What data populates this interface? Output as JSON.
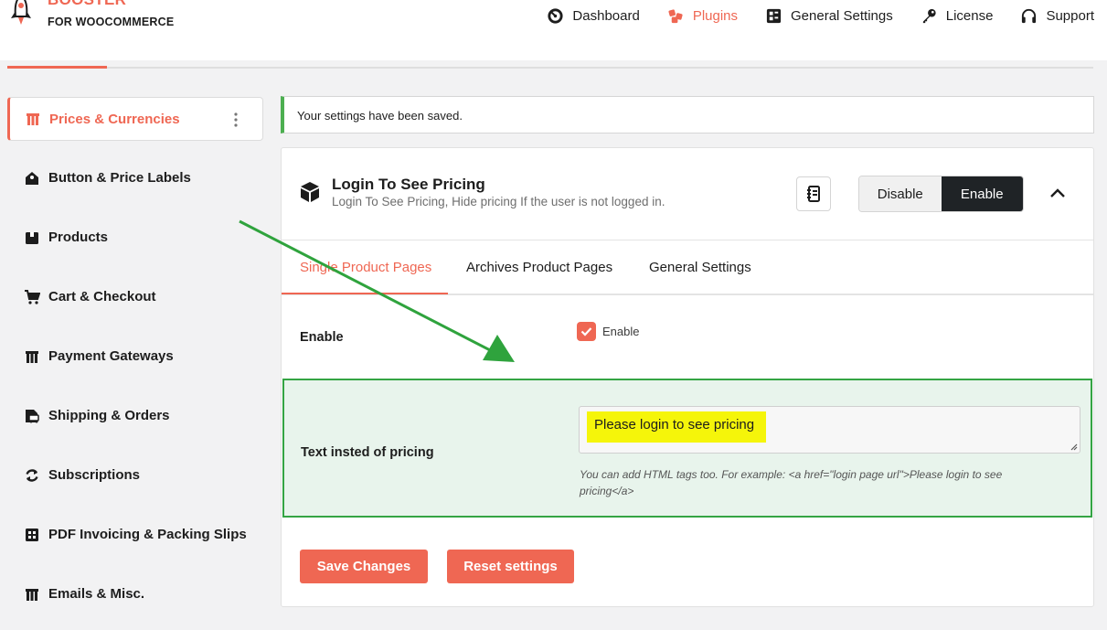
{
  "brand": {
    "name_top": "BOOSTER",
    "name_bottom": "FOR WOOCOMMERCE",
    "accent": "#ef6753"
  },
  "topnav": [
    {
      "label": "Dashboard",
      "icon": "dashboard-gauge-icon",
      "active": false
    },
    {
      "label": "Plugins",
      "icon": "plugins-cubes-icon",
      "active": true
    },
    {
      "label": "General Settings",
      "icon": "settings-grid-icon",
      "active": false
    },
    {
      "label": "License",
      "icon": "key-icon",
      "active": false
    },
    {
      "label": "Support",
      "icon": "headset-icon",
      "active": false
    }
  ],
  "sidebar": {
    "items": [
      {
        "label": "Prices & Currencies",
        "icon": "prices-icon",
        "active": true
      },
      {
        "label": "Button & Price Labels",
        "icon": "label-icon",
        "active": false
      },
      {
        "label": "Products",
        "icon": "box-icon",
        "active": false
      },
      {
        "label": "Cart & Checkout",
        "icon": "cart-icon",
        "active": false
      },
      {
        "label": "Payment Gateways",
        "icon": "payment-icon",
        "active": false
      },
      {
        "label": "Shipping & Orders",
        "icon": "shipping-icon",
        "active": false
      },
      {
        "label": "Subscriptions",
        "icon": "refresh-icon",
        "active": false
      },
      {
        "label": "PDF Invoicing & Packing Slips",
        "icon": "invoice-icon",
        "active": false
      },
      {
        "label": "Emails & Misc.",
        "icon": "email-icon",
        "active": false
      }
    ]
  },
  "notice": {
    "text": "Your settings have been saved.",
    "color": "#4caf50"
  },
  "module": {
    "title": "Login To See Pricing",
    "description": "Login To See Pricing, Hide pricing If the user is not logged in.",
    "disable_label": "Disable",
    "enable_label": "Enable",
    "enabled": true
  },
  "tabs": [
    {
      "label": "Single Product Pages",
      "active": true
    },
    {
      "label": "Archives Product Pages",
      "active": false
    },
    {
      "label": "General Settings",
      "active": false
    }
  ],
  "settings": {
    "enable": {
      "label": "Enable",
      "checkbox_label": "Enable",
      "checked": true
    },
    "text_instead": {
      "label": "Text insted of pricing",
      "value": "Please login to see pricing",
      "hint": "You can add HTML tags too. For example: <a href=\"login page url\">Please login to see pricing</a>"
    }
  },
  "actions": {
    "save_label": "Save Changes",
    "reset_label": "Reset settings"
  }
}
